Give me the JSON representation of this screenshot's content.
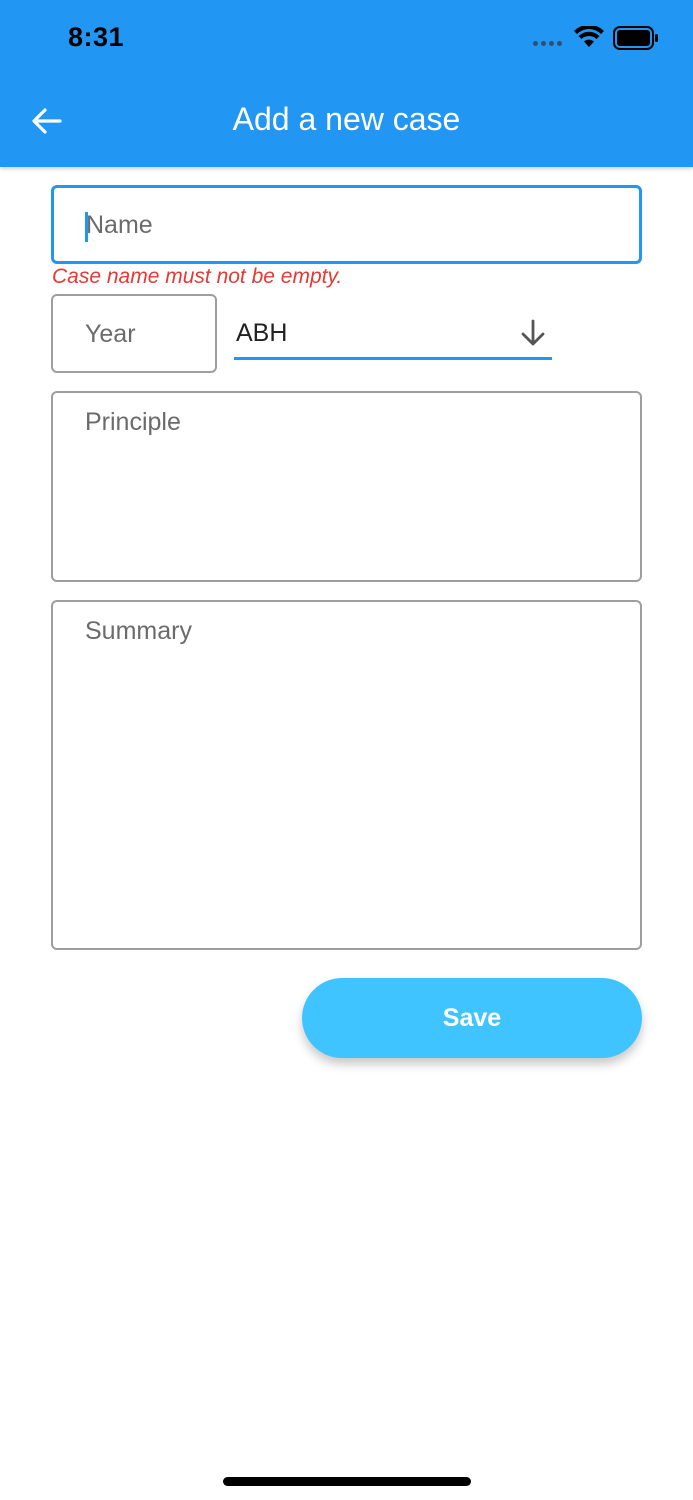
{
  "status_bar": {
    "time": "8:31"
  },
  "app_bar": {
    "title": "Add a new case",
    "back_icon": "arrow-left-icon"
  },
  "form": {
    "name": {
      "label": "Name",
      "value": "",
      "error": "Case name must not be empty."
    },
    "year": {
      "label": "Year",
      "value": ""
    },
    "category": {
      "selected": "ABH",
      "icon": "arrow-down-icon"
    },
    "principle": {
      "label": "Principle",
      "value": ""
    },
    "summary": {
      "label": "Summary",
      "value": ""
    }
  },
  "actions": {
    "save_label": "Save"
  },
  "colors": {
    "primary": "#2196F3",
    "accent": "#40C4FF",
    "error": "#e53935"
  }
}
